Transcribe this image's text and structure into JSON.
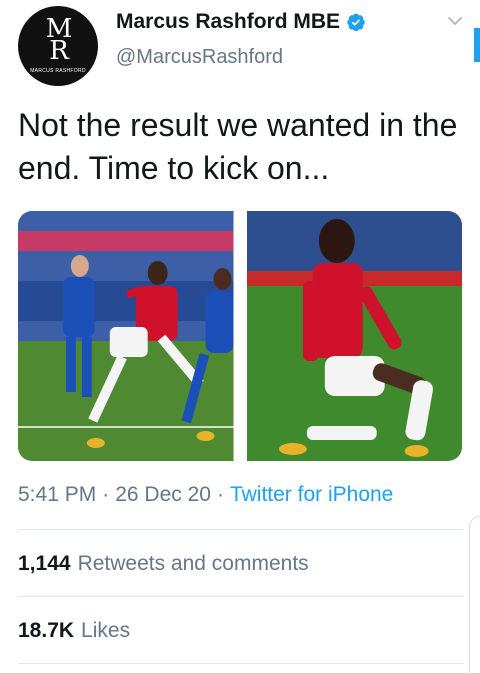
{
  "author": {
    "display_name": "Marcus Rashford MBE",
    "handle": "@MarcusRashford",
    "verified": true,
    "avatar_monogram_top": "M",
    "avatar_monogram_bottom": "R",
    "avatar_brand": "MARCUS RASHFORD"
  },
  "tweet": {
    "text": "Not the result we wanted in the end. Time to kick on...",
    "photo_count": 2
  },
  "meta": {
    "time": "5:41 PM",
    "separator": "·",
    "date": "26 Dec 20",
    "source": "Twitter for iPhone"
  },
  "stats": {
    "retweets_count": "1,144",
    "retweets_label": "Retweets and comments",
    "likes_count": "18.7K",
    "likes_label": "Likes"
  },
  "colors": {
    "accent": "#1da1f2",
    "secondary_text": "#657786",
    "united_red": "#d0112b",
    "leicester_blue": "#1d4fb8",
    "pitch_green": "#3f8a2c"
  },
  "icons": {
    "verified": "verified-badge-icon",
    "menu": "chevron-down-icon"
  }
}
